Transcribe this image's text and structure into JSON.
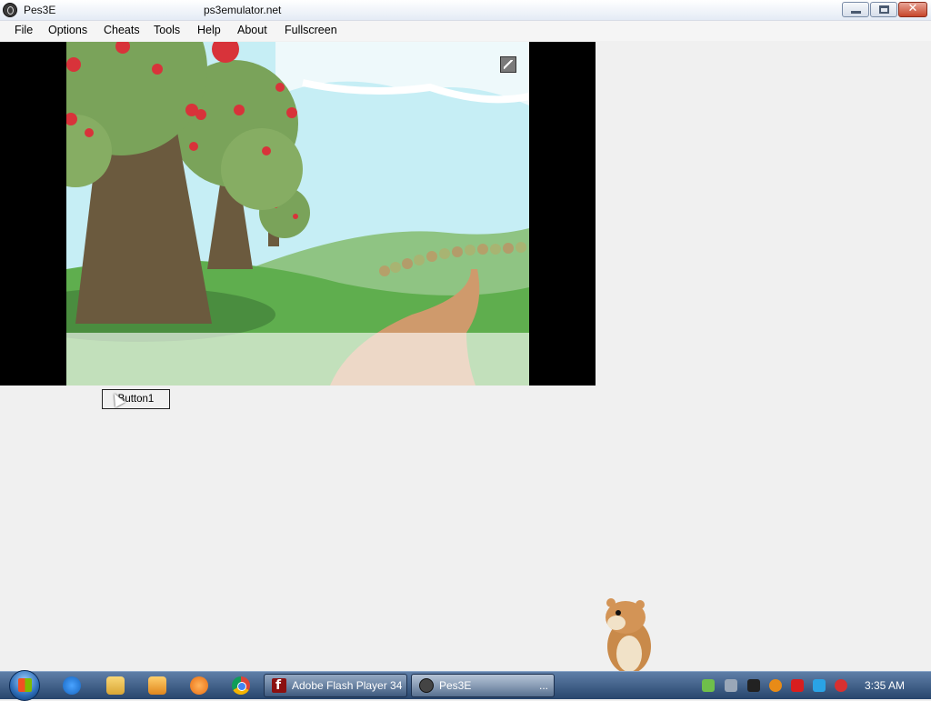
{
  "window": {
    "title": "Pes3E",
    "site_title": "ps3emulator.net",
    "close_symbol": "✕"
  },
  "menu": {
    "items": [
      "File",
      "Options",
      "Cheats",
      "Tools",
      "Help",
      "About",
      "Fullscreen"
    ]
  },
  "content": {
    "button_label": "Button1"
  },
  "taskbar": {
    "tasks": [
      {
        "label": "Adobe Flash Player 34",
        "icon": "flash-icon"
      },
      {
        "label": "Pes3E",
        "icon": "pes3e-icon",
        "overflow": "..."
      }
    ],
    "clock": "3:35 AM"
  },
  "colors": {
    "sky": "#c6eef5",
    "grass": "#5fae4e",
    "path": "#cf9a6c",
    "tree_foliage": "#7aa35a",
    "apple": "#d8333a"
  }
}
